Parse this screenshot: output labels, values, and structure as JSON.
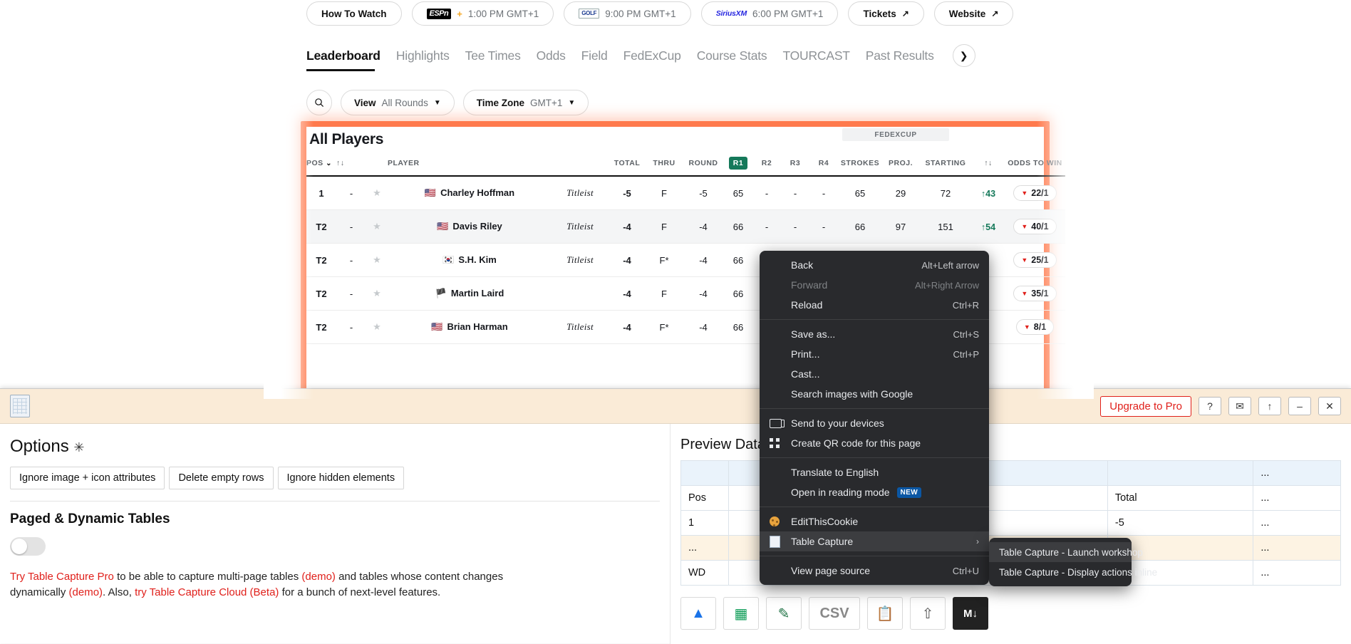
{
  "page": {
    "broadcast_pills": [
      {
        "label": "How To Watch",
        "logo": "",
        "time": ""
      },
      {
        "label": "",
        "logo": "espn-plus-logo",
        "time": "1:00 PM GMT+1"
      },
      {
        "label": "",
        "logo": "golf-channel-logo",
        "time": "9:00 PM GMT+1"
      },
      {
        "label": "",
        "logo": "siriusxm-logo",
        "time": "6:00 PM GMT+1"
      }
    ],
    "link_buttons": [
      {
        "label": "Tickets",
        "icon": "external-link-icon"
      },
      {
        "label": "Website",
        "icon": "external-link-icon"
      }
    ],
    "tabs": [
      {
        "label": "Leaderboard",
        "active": true
      },
      {
        "label": "Highlights",
        "active": false
      },
      {
        "label": "Tee Times",
        "active": false
      },
      {
        "label": "Odds",
        "active": false
      },
      {
        "label": "Field",
        "active": false
      },
      {
        "label": "FedExCup",
        "active": false
      },
      {
        "label": "Course Stats",
        "active": false
      },
      {
        "label": "TOURCAST",
        "active": false
      },
      {
        "label": "Past Results",
        "active": false
      }
    ],
    "tab_next_icon": "chevron-right-icon",
    "filters": {
      "search_icon": "search-icon",
      "view_label": "View",
      "view_value": "All Rounds",
      "timezone_label": "Time Zone",
      "timezone_value": "GMT+1",
      "caret_icon": "chevron-down-icon"
    },
    "leaderboard": {
      "title": "All Players",
      "fedexcup_band": "FEDEXCUP",
      "sort_icon": "sort-updown-icon",
      "pos_caret_icon": "chevron-down-icon",
      "columns": [
        "POS",
        "",
        "",
        "PLAYER",
        "",
        "TOTAL",
        "THRU",
        "ROUND",
        "R1",
        "R2",
        "R3",
        "R4",
        "STROKES",
        "PROJ.",
        "STARTING",
        "",
        "ODDS TO WIN"
      ],
      "active_round": "R1",
      "rows": [
        {
          "pos": "1",
          "change": "-",
          "star": "star-icon",
          "flag": "us-flag-icon",
          "name": "Charley Hoffman",
          "brand": "Titleist",
          "total": "-5",
          "thru": "F",
          "round": "-5",
          "r1": "65",
          "r2": "-",
          "r3": "-",
          "r4": "-",
          "strokes": "65",
          "proj": "29",
          "starting": "72",
          "move": "43",
          "move_dir": "up",
          "odds": "22/1",
          "odds_dir": "down"
        },
        {
          "pos": "T2",
          "change": "-",
          "star": "star-icon",
          "flag": "us-flag-icon",
          "name": "Davis Riley",
          "brand": "Titleist",
          "total": "-4",
          "thru": "F",
          "round": "-4",
          "r1": "66",
          "r2": "-",
          "r3": "-",
          "r4": "-",
          "strokes": "66",
          "proj": "97",
          "starting": "151",
          "move": "54",
          "move_dir": "up",
          "odds": "40/1",
          "odds_dir": "down"
        },
        {
          "pos": "T2",
          "change": "-",
          "star": "star-icon",
          "flag": "kr-flag-icon",
          "name": "S.H. Kim",
          "brand": "Titleist",
          "total": "-4",
          "thru": "F*",
          "round": "-4",
          "r1": "66",
          "r2": "-",
          "r3": "",
          "r4": "",
          "strokes": "",
          "proj": "",
          "starting": "",
          "move": "",
          "move_dir": "",
          "odds": "25/1",
          "odds_dir": "down"
        },
        {
          "pos": "T2",
          "change": "-",
          "star": "star-icon",
          "flag": "scotland-flag-icon",
          "name": "Martin Laird",
          "brand": "",
          "total": "-4",
          "thru": "F",
          "round": "-4",
          "r1": "66",
          "r2": "-",
          "r3": "",
          "r4": "",
          "strokes": "",
          "proj": "",
          "starting": "",
          "move": "",
          "move_dir": "",
          "odds": "35/1",
          "odds_dir": "down"
        },
        {
          "pos": "T2",
          "change": "-",
          "star": "star-icon",
          "flag": "us-flag-icon",
          "name": "Brian Harman",
          "brand": "Titleist",
          "total": "-4",
          "thru": "F*",
          "round": "-4",
          "r1": "66",
          "r2": "-",
          "r3": "",
          "r4": "",
          "strokes": "",
          "proj": "",
          "starting": "",
          "move": "",
          "move_dir": "",
          "odds": "8/1",
          "odds_dir": "down"
        }
      ]
    }
  },
  "extension": {
    "icon": "table-capture-icon",
    "upgrade_label": "Upgrade to Pro",
    "help_label": "?",
    "mail_label": "✉",
    "up_label": "↑",
    "minimize_label": "–",
    "close_label": "✕",
    "options_title": "Options",
    "options_asterisk": "✳",
    "option_buttons": [
      "Ignore image + icon attributes",
      "Delete empty rows",
      "Ignore hidden elements"
    ],
    "paged_title": "Paged & Dynamic Tables",
    "toggle_state": "off",
    "note_parts": {
      "a": "Try Table Capture Pro",
      "b": " to be able to capture multi-page tables ",
      "c": "(demo)",
      "d": " and tables whose content changes dynamically ",
      "e": "(demo)",
      "f": ". Also, ",
      "g": "try Table Capture Cloud (Beta)",
      "h": " for a bunch of next-level features."
    },
    "preview_title": "Preview Data",
    "preview_rows": [
      {
        "cells": [
          "",
          "",
          "",
          "",
          "..."
        ],
        "style": "blank"
      },
      {
        "cells": [
          "Pos",
          "",
          "",
          "Total",
          "..."
        ],
        "style": "white"
      },
      {
        "cells": [
          "1",
          "",
          "",
          "-5",
          "..."
        ],
        "style": "white"
      },
      {
        "cells": [
          "...",
          "",
          "",
          "",
          "..."
        ],
        "style": "cream"
      },
      {
        "cells": [
          "WD",
          "",
          "",
          "-",
          "..."
        ],
        "style": "white"
      }
    ],
    "export_icons": [
      "google-drive-icon",
      "google-sheets-icon",
      "excel-edit-icon",
      "csv-icon",
      "copy-icon",
      "share-icon",
      "markdown-icon"
    ]
  },
  "context_menu": {
    "groups": [
      [
        {
          "label": "Back",
          "key": "Alt+Left arrow",
          "disabled": false,
          "icon": ""
        },
        {
          "label": "Forward",
          "key": "Alt+Right Arrow",
          "disabled": true,
          "icon": ""
        },
        {
          "label": "Reload",
          "key": "Ctrl+R",
          "disabled": false,
          "icon": ""
        }
      ],
      [
        {
          "label": "Save as...",
          "key": "Ctrl+S",
          "disabled": false,
          "icon": ""
        },
        {
          "label": "Print...",
          "key": "Ctrl+P",
          "disabled": false,
          "icon": ""
        },
        {
          "label": "Cast...",
          "key": "",
          "disabled": false,
          "icon": ""
        },
        {
          "label": "Search images with Google",
          "key": "",
          "disabled": false,
          "icon": ""
        }
      ],
      [
        {
          "label": "Send to your devices",
          "key": "",
          "disabled": false,
          "icon": "devices-icon"
        },
        {
          "label": "Create QR code for this page",
          "key": "",
          "disabled": false,
          "icon": "qr-code-icon"
        }
      ],
      [
        {
          "label": "Translate to English",
          "key": "",
          "disabled": false,
          "icon": ""
        },
        {
          "label": "Open in reading mode",
          "key": "",
          "disabled": false,
          "icon": "",
          "badge": "NEW"
        }
      ],
      [
        {
          "label": "EditThisCookie",
          "key": "",
          "disabled": false,
          "icon": "cookie-icon"
        },
        {
          "label": "Table Capture",
          "key": "",
          "disabled": false,
          "icon": "table-capture-icon",
          "submenu": true,
          "highlighted": true
        }
      ],
      [
        {
          "label": "View page source",
          "key": "Ctrl+U",
          "disabled": false,
          "icon": ""
        }
      ]
    ],
    "submenu_items": [
      {
        "label": "Table Capture - Launch workshop",
        "highlighted": true
      },
      {
        "label": "Table Capture - Display actions inline",
        "highlighted": false
      }
    ]
  }
}
